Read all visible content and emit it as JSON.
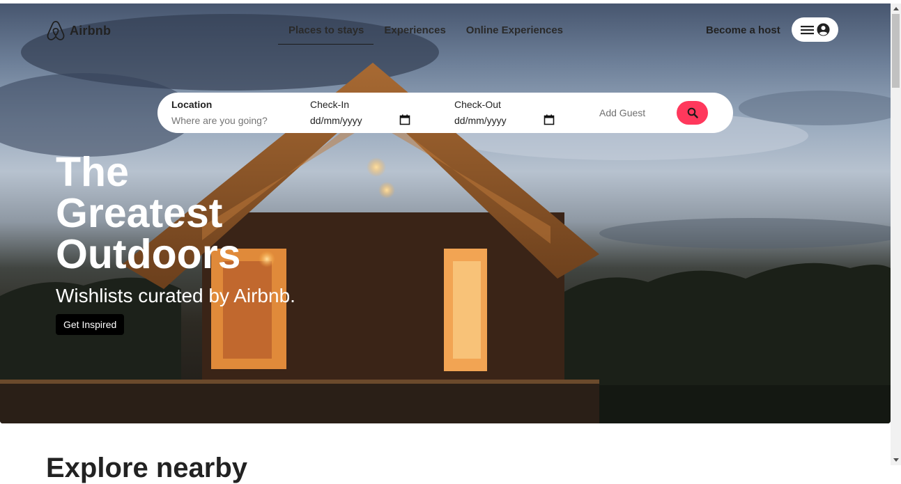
{
  "brand": {
    "name": "Airbnb",
    "icon": "airbnb-logo-icon",
    "accent_color": "#ff385c"
  },
  "nav": {
    "tabs": [
      {
        "label": "Places to stays",
        "active": true
      },
      {
        "label": "Experiences",
        "active": false
      },
      {
        "label": "Online Experiences",
        "active": false
      }
    ],
    "host_label": "Become a host",
    "profile_icons": [
      "menu-icon",
      "user-circle-icon"
    ]
  },
  "search": {
    "location": {
      "label": "Location",
      "placeholder": "Where are you going?"
    },
    "check_in": {
      "label": "Check-In",
      "value": "dd/mm/yyyy"
    },
    "check_out": {
      "label": "Check-Out",
      "value": "dd/mm/yyyy"
    },
    "guest_label": "Add Guest",
    "button_icon": "search-icon"
  },
  "hero": {
    "title_lines": [
      "The",
      "Greatest",
      "Outdoors"
    ],
    "subtitle": "Wishlists curated by Airbnb.",
    "cta_label": "Get Inspired"
  },
  "next_section": {
    "title": "Explore nearby"
  }
}
